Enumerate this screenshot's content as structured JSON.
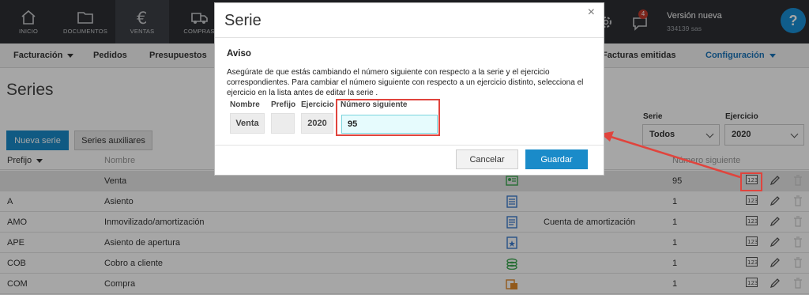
{
  "topnav": {
    "items": [
      {
        "label": "INICIO",
        "icon": "home-icon"
      },
      {
        "label": "DOCUMENTOS",
        "icon": "folder-icon"
      },
      {
        "label": "VENTAS",
        "icon": "euro-icon"
      },
      {
        "label": "COMPRAS",
        "icon": "truck-icon"
      }
    ],
    "notification_count": "4",
    "version_label": "Versión nueva",
    "company": "334139 sas",
    "help_label": "?"
  },
  "subnav": {
    "items": [
      "Facturación",
      "Pedidos",
      "Presupuestos",
      "Facturas emitidas",
      "Configuración"
    ]
  },
  "page": {
    "title": "Series",
    "new_button": "Nueva serie",
    "aux_button": "Series auxiliares",
    "serie_label": "Serie",
    "serie_value": "Todos",
    "ejercicio_label": "Ejercicio",
    "ejercicio_value": "2020"
  },
  "table": {
    "headers": {
      "prefijo": "Prefijo",
      "nombre": "Nombre",
      "numero": "Número siguiente"
    },
    "rows": [
      {
        "prefijo": "",
        "nombre": "Venta",
        "cuenta": "",
        "numero": "95",
        "icon": "person-card-icon",
        "icon_color": "#3aa84f"
      },
      {
        "prefijo": "A",
        "nombre": "Asiento",
        "cuenta": "",
        "numero": "1",
        "icon": "ledger-icon",
        "icon_color": "#3b7bd0"
      },
      {
        "prefijo": "AMO",
        "nombre": "Inmovilizado/amortización",
        "cuenta": "Cuenta de amortización",
        "numero": "1",
        "icon": "list-doc-icon",
        "icon_color": "#3b7bd0"
      },
      {
        "prefijo": "APE",
        "nombre": "Asiento de apertura",
        "cuenta": "",
        "numero": "1",
        "icon": "star-doc-icon",
        "icon_color": "#3b7bd0"
      },
      {
        "prefijo": "COB",
        "nombre": "Cobro a cliente",
        "cuenta": "",
        "numero": "1",
        "icon": "coins-icon",
        "icon_color": "#3aa84f"
      },
      {
        "prefijo": "COM",
        "nombre": "Compra",
        "cuenta": "",
        "numero": "1",
        "icon": "cart-doc-icon",
        "icon_color": "#e08a2c"
      }
    ]
  },
  "modal": {
    "title": "Serie",
    "close": "×",
    "heading": "Aviso",
    "message": "Asegúrate de que estás cambiando el número siguiente con respecto a la serie y el ejercicio correspondientes. Para cambiar el número siguiente con respecto a un ejercicio distinto, selecciona el ejercicio en la lista antes de editar la serie .",
    "labels": {
      "nombre": "Nombre",
      "prefijo": "Prefijo",
      "ejercicio": "Ejercicio",
      "numero": "Número siguiente"
    },
    "values": {
      "nombre": "Venta",
      "prefijo": "",
      "ejercicio": "2020",
      "numero": "95"
    },
    "cancel": "Cancelar",
    "save": "Guardar"
  },
  "colors": {
    "accent": "#1a8bc9",
    "highlight": "#e0443d"
  }
}
